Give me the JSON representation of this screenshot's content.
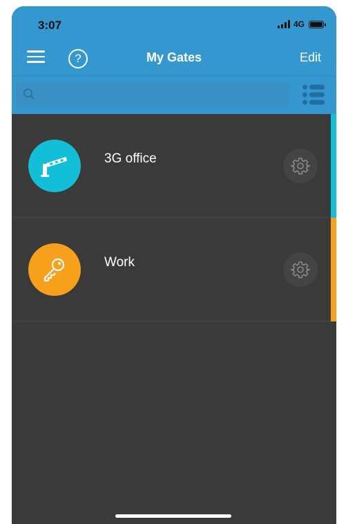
{
  "status_bar": {
    "time": "3:07",
    "network": "4G",
    "signal_bars": 4,
    "battery_level": 1.0
  },
  "nav": {
    "title": "My Gates",
    "edit_label": "Edit",
    "help_label": "?",
    "menu_icon": "hamburger-icon",
    "help_icon": "question-icon"
  },
  "search": {
    "placeholder": "",
    "value": "",
    "icon": "search-icon",
    "list_view_icon": "list-view-icon"
  },
  "gates": [
    {
      "name": "3G office",
      "icon": "barrier-gate-icon",
      "color": "#12bfd6"
    },
    {
      "name": "Work",
      "icon": "key-icon",
      "color": "#f7a01b"
    }
  ],
  "colors": {
    "header": "#3497cf",
    "background": "#3a3a3a",
    "teal_accent": "#12bfd6",
    "orange_accent": "#f7a01b"
  }
}
